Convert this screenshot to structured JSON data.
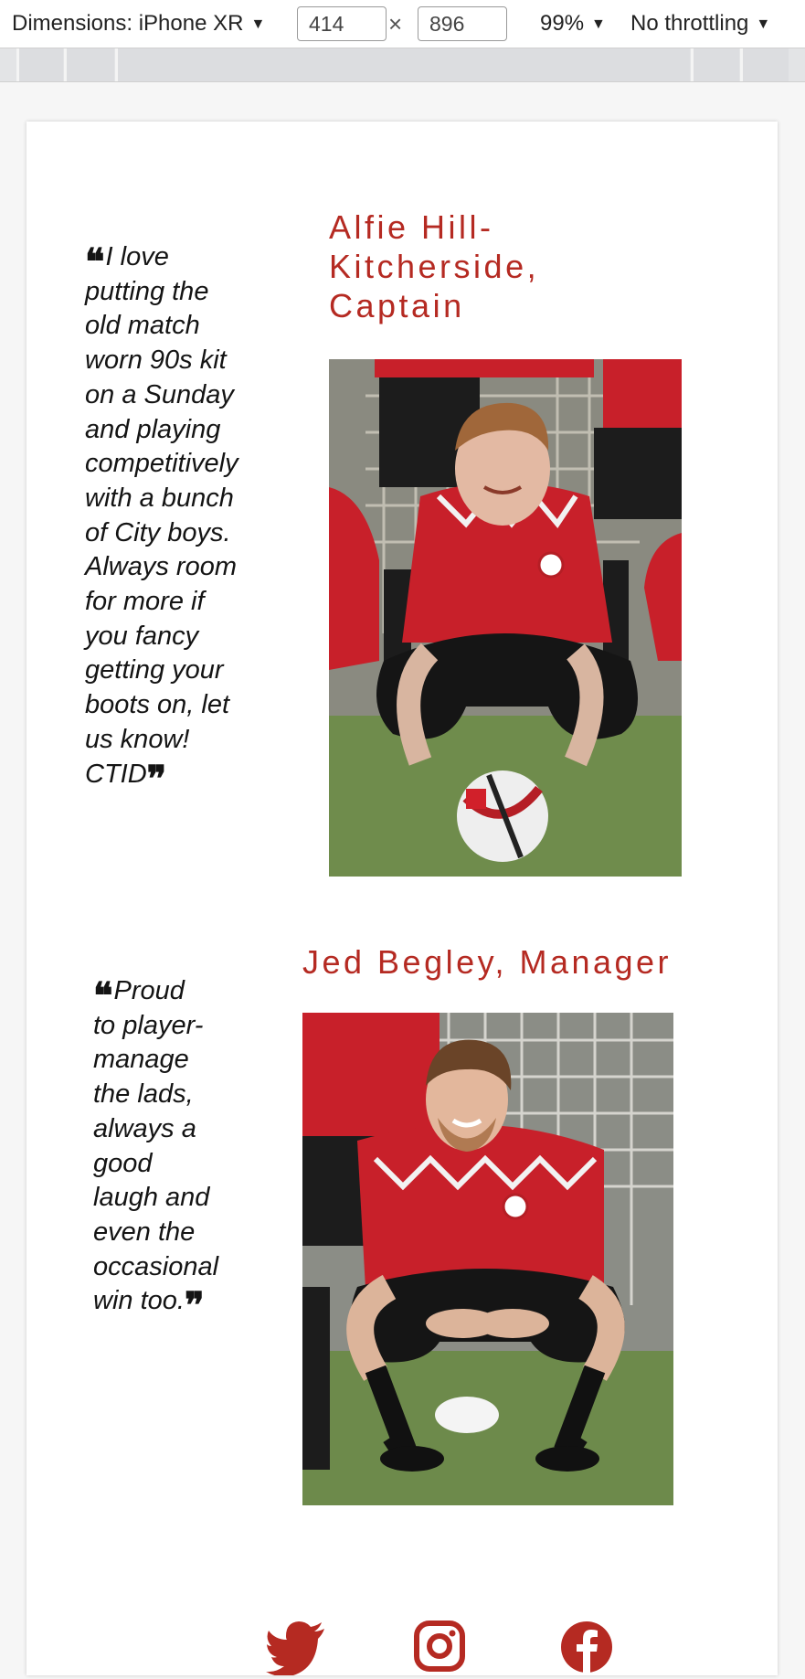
{
  "devtools": {
    "dimensions_label": "Dimensions: iPhone XR",
    "width_value": "414",
    "height_value": "896",
    "times_symbol": "×",
    "zoom_label": "99%",
    "throttling_label": "No throttling",
    "caret": "▼"
  },
  "players": [
    {
      "name": "Alfie Hill-Kitcherside, Captain",
      "name_lines": [
        "Alfie Hill-",
        "Kitcherside,",
        "Captain"
      ],
      "quote_lines": [
        "I love",
        "putting the",
        "old match",
        "worn 90s kit",
        "on a Sunday",
        "and playing",
        "competitively",
        "with a bunch",
        "of City boys.",
        "Always room",
        "for more if",
        "you fancy",
        "getting your",
        "boots on, let",
        "us know!",
        "CTID"
      ],
      "photo_icon": "player-photo-alfie"
    },
    {
      "name": "Jed Begley, Manager",
      "quote_lines": [
        "Proud",
        "to player-",
        "manage",
        "the lads,",
        "always a",
        "good",
        "laugh and",
        "even the",
        "occasional",
        "win too."
      ],
      "photo_icon": "player-photo-jed"
    }
  ],
  "social": [
    "twitter-icon",
    "instagram-icon",
    "facebook-icon"
  ],
  "colors": {
    "accent": "#b52a22",
    "kit_red": "#c8202a",
    "text": "#141414",
    "page_bg": "#f6f6f6"
  }
}
